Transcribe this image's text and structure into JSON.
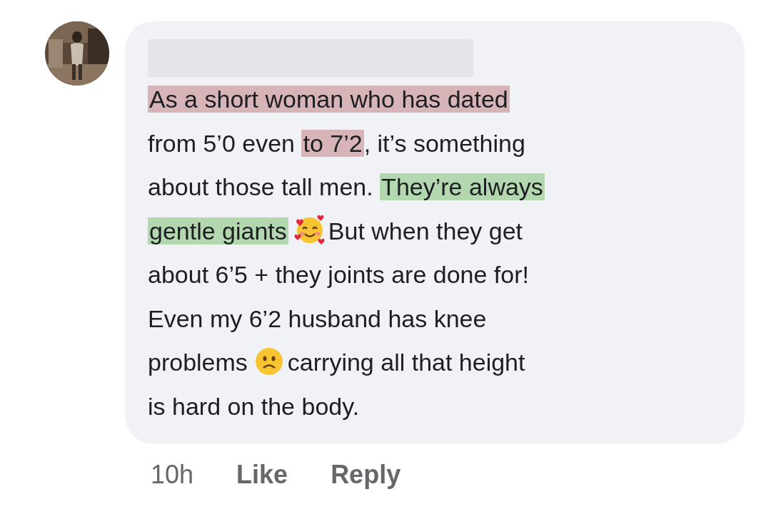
{
  "comment": {
    "author_redacted": true,
    "lines": [
      [
        {
          "kind": "text",
          "text": "As a short woman who has dated",
          "color": "#d6b4b7"
        }
      ],
      [
        {
          "kind": "text",
          "text": "from 5’0 even "
        },
        {
          "kind": "text",
          "text": "to 7’2",
          "color": "#d6b4b7"
        },
        {
          "kind": "text",
          "text": ", it’s something"
        }
      ],
      [
        {
          "kind": "text",
          "text": "about those tall men. "
        },
        {
          "kind": "text",
          "text": "They’re always",
          "color": "#b3d8b0"
        }
      ],
      [
        {
          "kind": "text",
          "text": "gentle giants",
          "color": "#b3d8b0"
        },
        {
          "kind": "hearts_emoji"
        },
        {
          "kind": "text",
          "text": "But when they get"
        }
      ],
      [
        {
          "kind": "text",
          "text": "about 6’5 + they joints are done for!"
        }
      ],
      [
        {
          "kind": "text",
          "text": "Even my 6’2 husband has knee"
        }
      ],
      [
        {
          "kind": "text",
          "text": "problems"
        },
        {
          "kind": "sad_emoji"
        },
        {
          "kind": "text",
          "text": "carrying all that height"
        }
      ],
      [
        {
          "kind": "text",
          "text": "is hard on the body."
        }
      ]
    ],
    "time": "10h",
    "actions": [
      "Like",
      "Reply"
    ]
  }
}
